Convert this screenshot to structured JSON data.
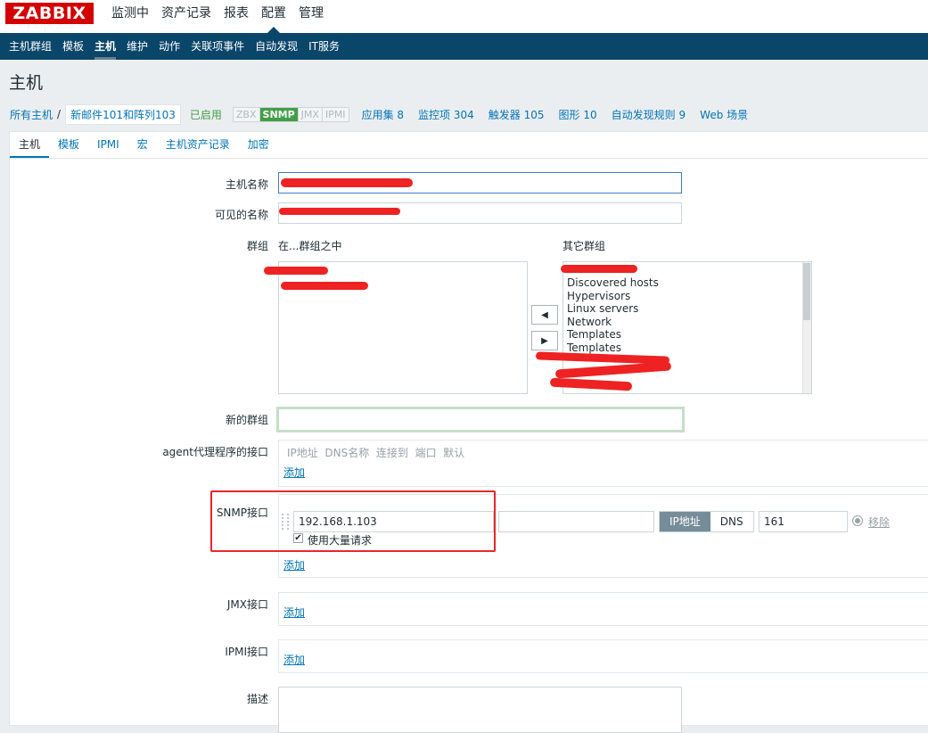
{
  "header": {
    "logo": "ZABBIX",
    "menu": [
      "监测中",
      "资产记录",
      "报表",
      "配置",
      "管理"
    ],
    "active_menu_index": 3
  },
  "subnav": {
    "items": [
      "主机群组",
      "模板",
      "主机",
      "维护",
      "动作",
      "关联项事件",
      "自动发现",
      "IT服务"
    ],
    "active_index": 2
  },
  "page_title": "主机",
  "breadcrumb": {
    "all_hosts": "所有主机",
    "separator": "/",
    "current_host": "新邮件101和阵列103",
    "status": "已启用",
    "availability": [
      "ZBX",
      "SNMP",
      "JMX",
      "IPMI"
    ],
    "availability_active": "SNMP",
    "links": [
      {
        "label": "应用集",
        "count": "8"
      },
      {
        "label": "监控项",
        "count": "304"
      },
      {
        "label": "触发器",
        "count": "105"
      },
      {
        "label": "图形",
        "count": "10"
      },
      {
        "label": "自动发现规则",
        "count": "9"
      },
      {
        "label": "Web 场景",
        "count": ""
      }
    ]
  },
  "tabs": [
    "主机",
    "模板",
    "IPMI",
    "宏",
    "主机资产记录",
    "加密"
  ],
  "active_tab": "主机",
  "form": {
    "host_name_label": "主机名称",
    "visible_name_label": "可见的名称",
    "groups_label": "群组",
    "in_groups_label": "在...群组之中",
    "other_groups_label": "其它群组",
    "other_groups": [
      "Discovered hosts",
      "Hypervisors",
      "Linux servers",
      "Network",
      "Templates",
      "Templates"
    ],
    "new_group_label": "新的群组",
    "agent_iface_label": "agent代理程序的接口",
    "iface_columns": [
      "IP地址",
      "DNS名称",
      "连接到",
      "端口",
      "默认"
    ],
    "add_label": "添加",
    "snmp_iface_label": "SNMP接口",
    "snmp_ip": "192.168.1.103",
    "snmp_dns": "",
    "connect_ip_label": "IP地址",
    "connect_dns_label": "DNS",
    "snmp_port": "161",
    "remove_label": "移除",
    "bulk_label": "使用大量请求",
    "jmx_iface_label": "JMX接口",
    "ipmi_iface_label": "IPMI接口",
    "description_label": "描述"
  },
  "colors": {
    "logo_red": "#d40000",
    "nav_blue": "#0a466a",
    "link_blue": "#0275b8",
    "enabled_green": "#429e47",
    "annotation_red": "#e8272b"
  }
}
